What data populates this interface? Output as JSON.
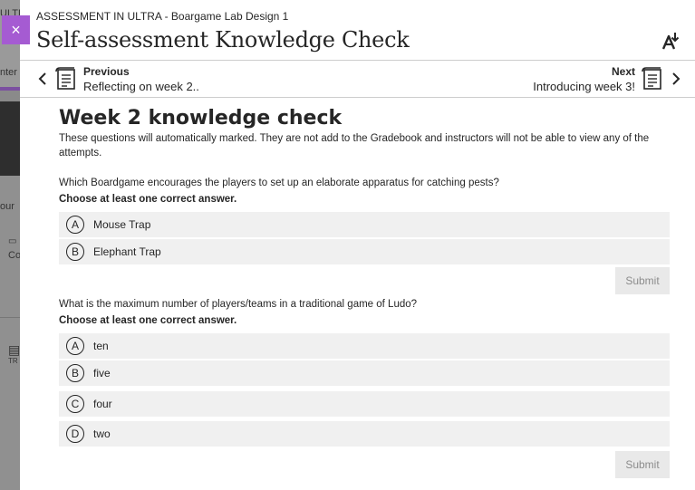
{
  "background": {
    "fragments": [
      "ULTRA",
      "nter",
      "our",
      "Co",
      "TR"
    ]
  },
  "dialog": {
    "close_label": "×",
    "breadcrumb": "ASSESSMENT IN ULTRA - Boargame Lab Design 1",
    "title": "Self-assessment Knowledge Check"
  },
  "nav": {
    "prev_label": "Previous",
    "prev_title": "Reflecting on week 2..",
    "next_label": "Next",
    "next_title": "Introducing week 3!"
  },
  "quiz": {
    "title": "Week 2 knowledge check",
    "description": "These questions will automatically marked. They are not add to the Gradebook and instructors will not be able to view any of the attempts.",
    "questions": [
      {
        "text": "Which Boardgame encourages the players to set up an elaborate apparatus for catching pests?",
        "instruction": "Choose at least one correct answer.",
        "options": [
          {
            "letter": "A",
            "label": "Mouse Trap"
          },
          {
            "letter": "B",
            "label": "Elephant Trap"
          }
        ],
        "submit_label": "Submit"
      },
      {
        "text": "What is the maximum number of players/teams in a traditional game of Ludo?",
        "instruction": "Choose at least one correct answer.",
        "options": [
          {
            "letter": "A",
            "label": "ten"
          },
          {
            "letter": "B",
            "label": "five"
          },
          {
            "letter": "C",
            "label": "four"
          },
          {
            "letter": "D",
            "label": "two"
          }
        ],
        "submit_label": "Submit"
      }
    ]
  },
  "colors": {
    "accent": "#a55bd2",
    "option_bg": "#f0f0f0",
    "submit_bg": "#e9e9e9",
    "submit_text": "#8c8c8c"
  }
}
